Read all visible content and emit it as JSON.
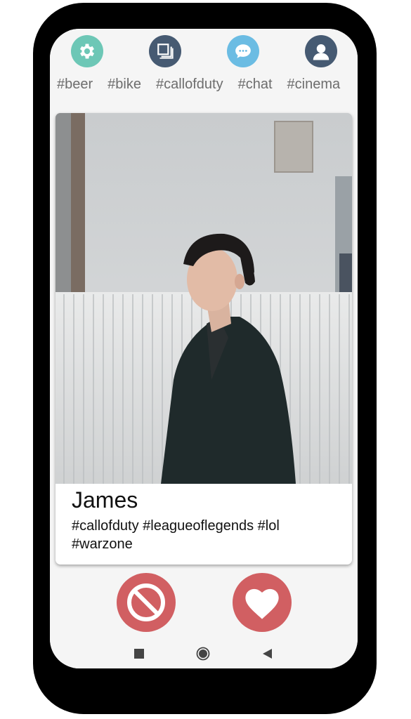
{
  "topbar": {
    "icons": [
      {
        "name": "settings",
        "icon": "gear-icon",
        "color": "#6dc7b6"
      },
      {
        "name": "stack",
        "icon": "layers-icon",
        "color": "#465a72"
      },
      {
        "name": "chat",
        "icon": "chat-bubble-icon",
        "color": "#6bbce3"
      },
      {
        "name": "profile",
        "icon": "user-icon",
        "color": "#465a72"
      }
    ],
    "tags": [
      "#beer",
      "#bike",
      "#callofduty",
      "#chat",
      "#cinema"
    ]
  },
  "profile": {
    "name": "James",
    "tags": "#callofduty #leagueoflegends #lol #warzone"
  },
  "actions": {
    "reject_icon": "block-icon",
    "like_icon": "heart-icon",
    "color": "#d15f62"
  },
  "navbar": {
    "items": [
      "recents-icon",
      "home-icon",
      "back-icon"
    ]
  }
}
